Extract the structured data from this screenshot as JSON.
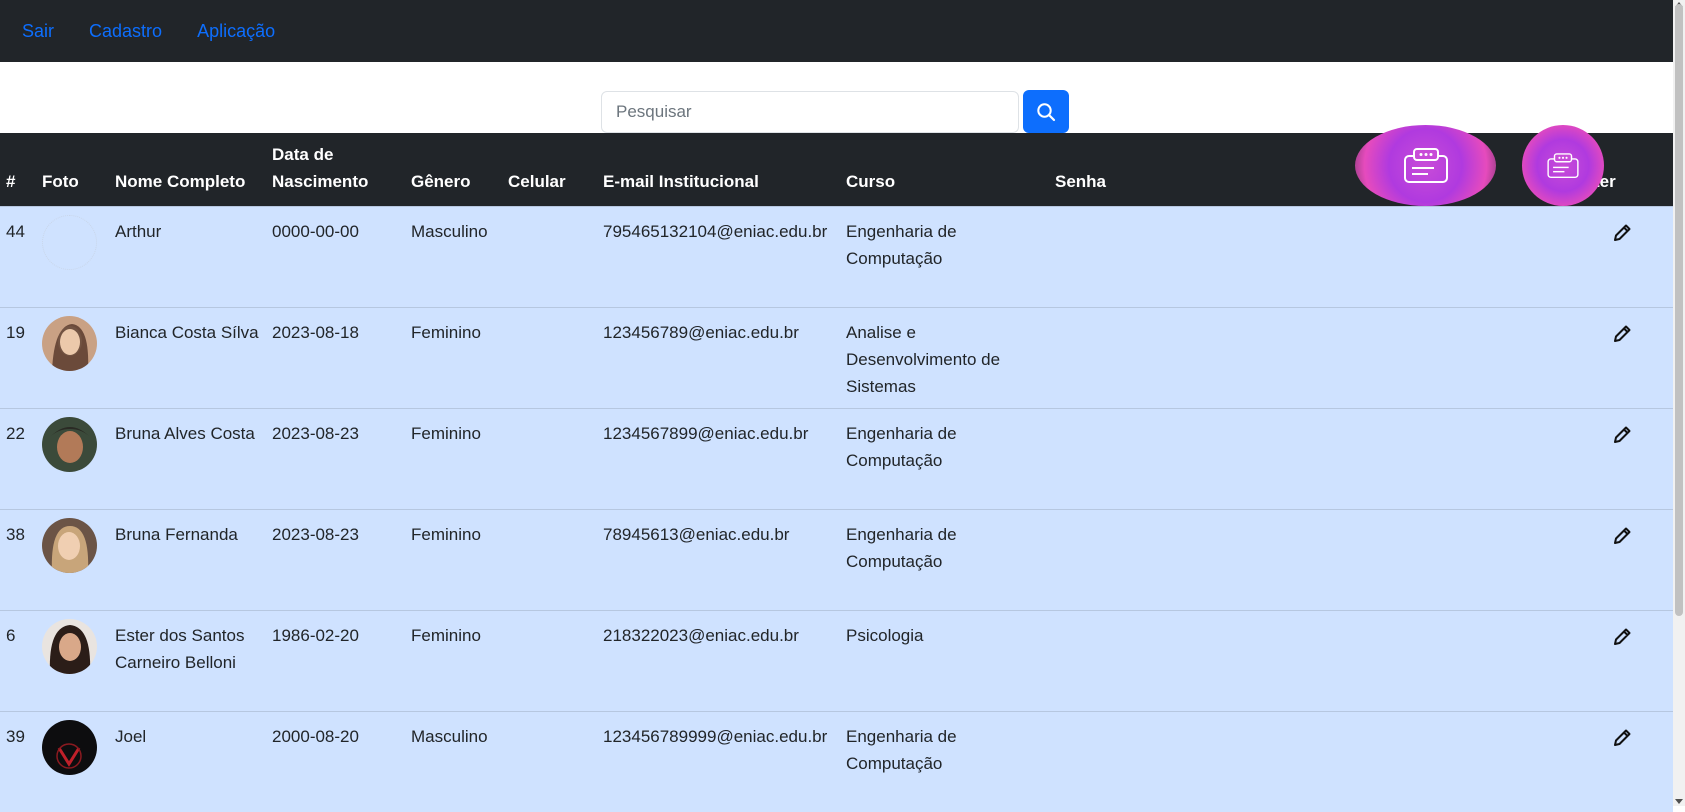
{
  "nav": {
    "items": [
      {
        "label": "Sair"
      },
      {
        "label": "Cadastro"
      },
      {
        "label": "Aplicação"
      }
    ]
  },
  "search": {
    "placeholder": "Pesquisar",
    "value": "",
    "icon": "search-icon"
  },
  "table": {
    "headers": {
      "id": "#",
      "photo": "Foto",
      "name": "Nome Completo",
      "birth": "Data de Nascimento",
      "gender": "Gênero",
      "phone": "Celular",
      "email": "E-mail Institucional",
      "course": "Curso",
      "password": "Senha",
      "edit": "Alter"
    },
    "rows": [
      {
        "id": "44",
        "name": "Arthur",
        "birth": "0000-00-00",
        "gender": "Masculino",
        "phone": "",
        "email": "795465132104@eniac.edu.br",
        "course": "Engenharia de Computação",
        "password": ""
      },
      {
        "id": "19",
        "name": "Bianca Costa Sílva",
        "birth": "2023-08-18",
        "gender": "Feminino",
        "phone": "",
        "email": "123456789@eniac.edu.br",
        "course": "Analise e Desenvolvimento de Sistemas",
        "password": ""
      },
      {
        "id": "22",
        "name": "Bruna Alves Costa",
        "birth": "2023-08-23",
        "gender": "Feminino",
        "phone": "",
        "email": "1234567899@eniac.edu.br",
        "course": "Engenharia de Computação",
        "password": ""
      },
      {
        "id": "38",
        "name": "Bruna Fernanda",
        "birth": "2023-08-23",
        "gender": "Feminino",
        "phone": "",
        "email": "78945613@eniac.edu.br",
        "course": "Engenharia de Computação",
        "password": ""
      },
      {
        "id": "6",
        "name": "Ester dos Santos Carneiro Belloni",
        "birth": "1986-02-20",
        "gender": "Feminino",
        "phone": "",
        "email": "218322023@eniac.edu.br",
        "course": "Psicologia",
        "password": ""
      },
      {
        "id": "39",
        "name": "Joel",
        "birth": "2000-08-20",
        "gender": "Masculino",
        "phone": "",
        "email": "123456789999@eniac.edu.br",
        "course": "Engenharia de Computação",
        "password": ""
      }
    ]
  },
  "colors": {
    "navbar": "#212529",
    "link": "#0d6efd",
    "row_background": "#cfe2ff",
    "search_button": "#0d6efd",
    "overlay_widget": "#b03adf"
  },
  "icons": {
    "edit": "pencil-icon",
    "overlay": "chat-window-icon"
  }
}
